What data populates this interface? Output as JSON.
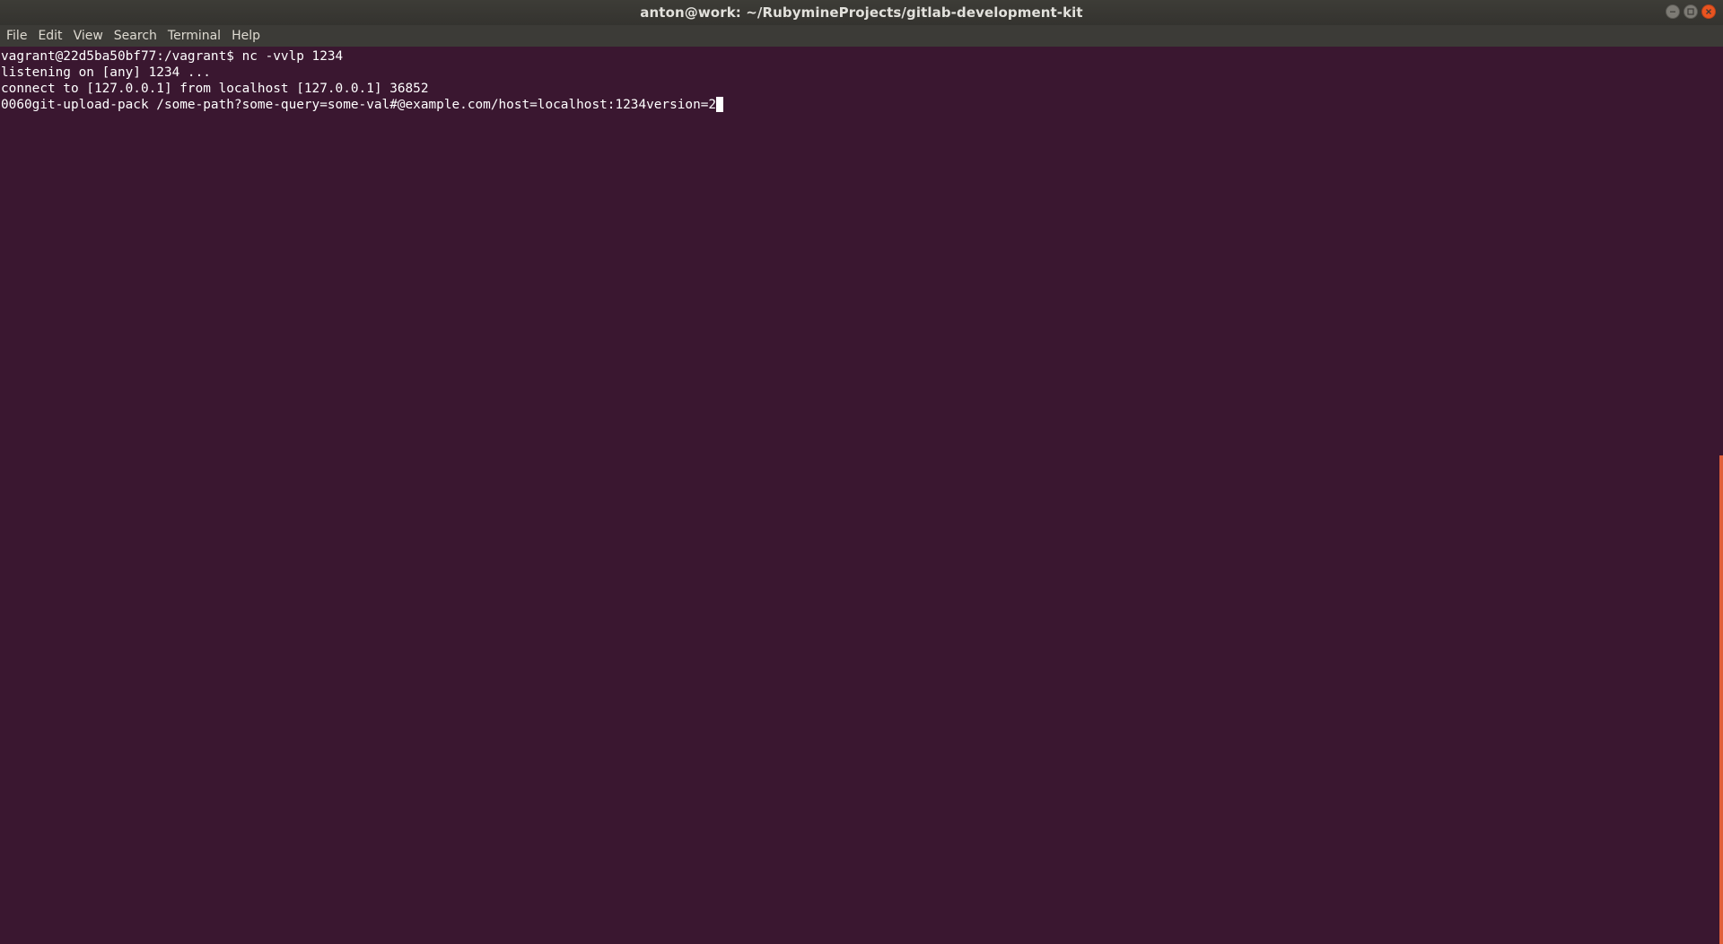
{
  "window": {
    "title": "anton@work: ~/RubymineProjects/gitlab-development-kit",
    "controls": [
      "minimize-icon",
      "maximize-icon",
      "close-icon"
    ]
  },
  "menu": {
    "items": [
      "File",
      "Edit",
      "View",
      "Search",
      "Terminal",
      "Help"
    ]
  },
  "terminal": {
    "lines": [
      "vagrant@22d5ba50bf77:/vagrant$ nc -vvlp 1234",
      "listening on [any] 1234 ...",
      "connect to [127.0.0.1] from localhost [127.0.0.1] 36852",
      "0060git-upload-pack /some-path?some-query=some-val#@example.com/host=localhost:1234version=2"
    ],
    "colors": {
      "background": "#3a1730",
      "foreground": "#ffffff",
      "scroll_thumb": "#e0603a"
    }
  }
}
